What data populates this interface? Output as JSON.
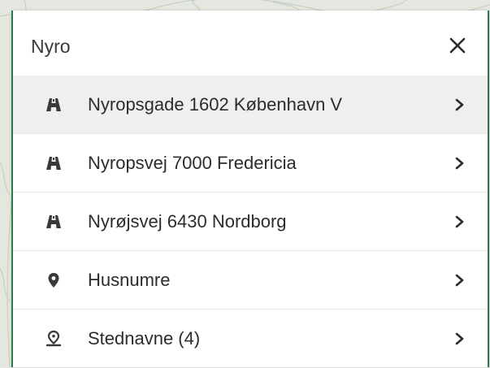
{
  "search": {
    "value": "Nyro",
    "close_icon": "close-icon"
  },
  "results": [
    {
      "label": "Nyropsgade 1602 København V",
      "icon": "road-icon",
      "selected": true
    },
    {
      "label": "Nyropsvej 7000 Fredericia",
      "icon": "road-icon",
      "selected": false
    },
    {
      "label": "Nyrøjsvej 6430 Nordborg",
      "icon": "road-icon",
      "selected": false
    },
    {
      "label": "Husnumre",
      "icon": "map-pin-icon",
      "selected": false
    },
    {
      "label": "Stednavne (4)",
      "icon": "place-marker-icon",
      "selected": false
    }
  ],
  "colors": {
    "accent_border": "#2f7a4b",
    "selected_row": "#efefef",
    "icon": "#3a3a3a"
  }
}
